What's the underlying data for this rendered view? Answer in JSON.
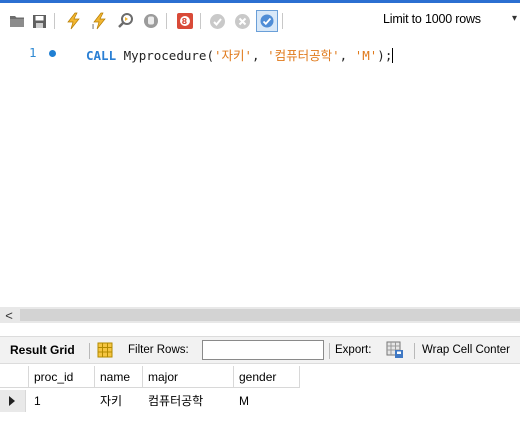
{
  "toolbar": {
    "limit_label": "Limit to 1000 rows",
    "icons": [
      "open-folder-icon",
      "save-icon",
      "execute-icon",
      "execute-current-icon",
      "explain-icon",
      "stop-icon",
      "toggle-error-icon",
      "commit-icon",
      "rollback-icon",
      "autocommit-icon",
      "dropdown-caret"
    ],
    "accent_color": "#2b6fd1"
  },
  "editor": {
    "line_number": "1",
    "code": {
      "keyword": "CALL",
      "procedure": "Myprocedure",
      "open": "(",
      "arg1": "'자키'",
      "comma1": ", ",
      "arg2": "'컴퓨터공학'",
      "comma2": ", ",
      "arg3": "'M'",
      "close": ");"
    }
  },
  "scrollbar": {
    "left_arrow": "<"
  },
  "result_bar": {
    "title": "Result Grid",
    "filter_label": "Filter Rows:",
    "filter_value": "",
    "export_label": "Export:",
    "wrap_label": "Wrap Cell Conter"
  },
  "result_table": {
    "columns": [
      "proc_id",
      "name",
      "major",
      "gender"
    ],
    "rows": [
      [
        "1",
        "자키",
        "컴퓨터공학",
        "M"
      ]
    ]
  }
}
